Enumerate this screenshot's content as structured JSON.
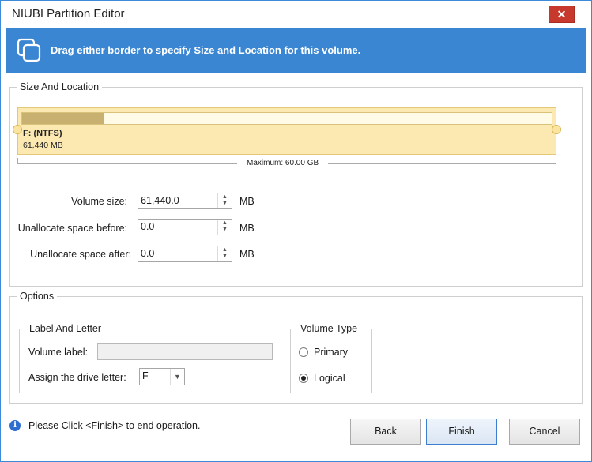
{
  "window": {
    "title": "NIUBI Partition Editor",
    "close_glyph": "✕"
  },
  "banner": {
    "text": "Drag either border to specify Size and Location for this volume.",
    "icon": "copy-icon"
  },
  "size_location": {
    "legend": "Size And Location",
    "partition": {
      "name": "F: (NTFS)",
      "size": "61,440 MB",
      "used_fraction": 0.155
    },
    "maximum": "Maximum: 60.00 GB",
    "fields": [
      {
        "label": "Volume size:",
        "value": "61,440.0",
        "unit": "MB"
      },
      {
        "label": "Unallocate space before:",
        "value": "0.0",
        "unit": "MB"
      },
      {
        "label": "Unallocate space after:",
        "value": "0.0",
        "unit": "MB"
      }
    ]
  },
  "options": {
    "legend": "Options",
    "label_letter": {
      "legend": "Label And Letter",
      "volume_label": "Volume label:",
      "volume_label_value": "",
      "drive_letter_label": "Assign the drive letter:",
      "drive_letter_value": "F"
    },
    "volume_type": {
      "legend": "Volume Type",
      "primary": "Primary",
      "logical": "Logical",
      "selected": "Logical"
    }
  },
  "footer": {
    "status": "Please Click <Finish> to end operation.",
    "back": "Back",
    "finish": "Finish",
    "cancel": "Cancel"
  }
}
